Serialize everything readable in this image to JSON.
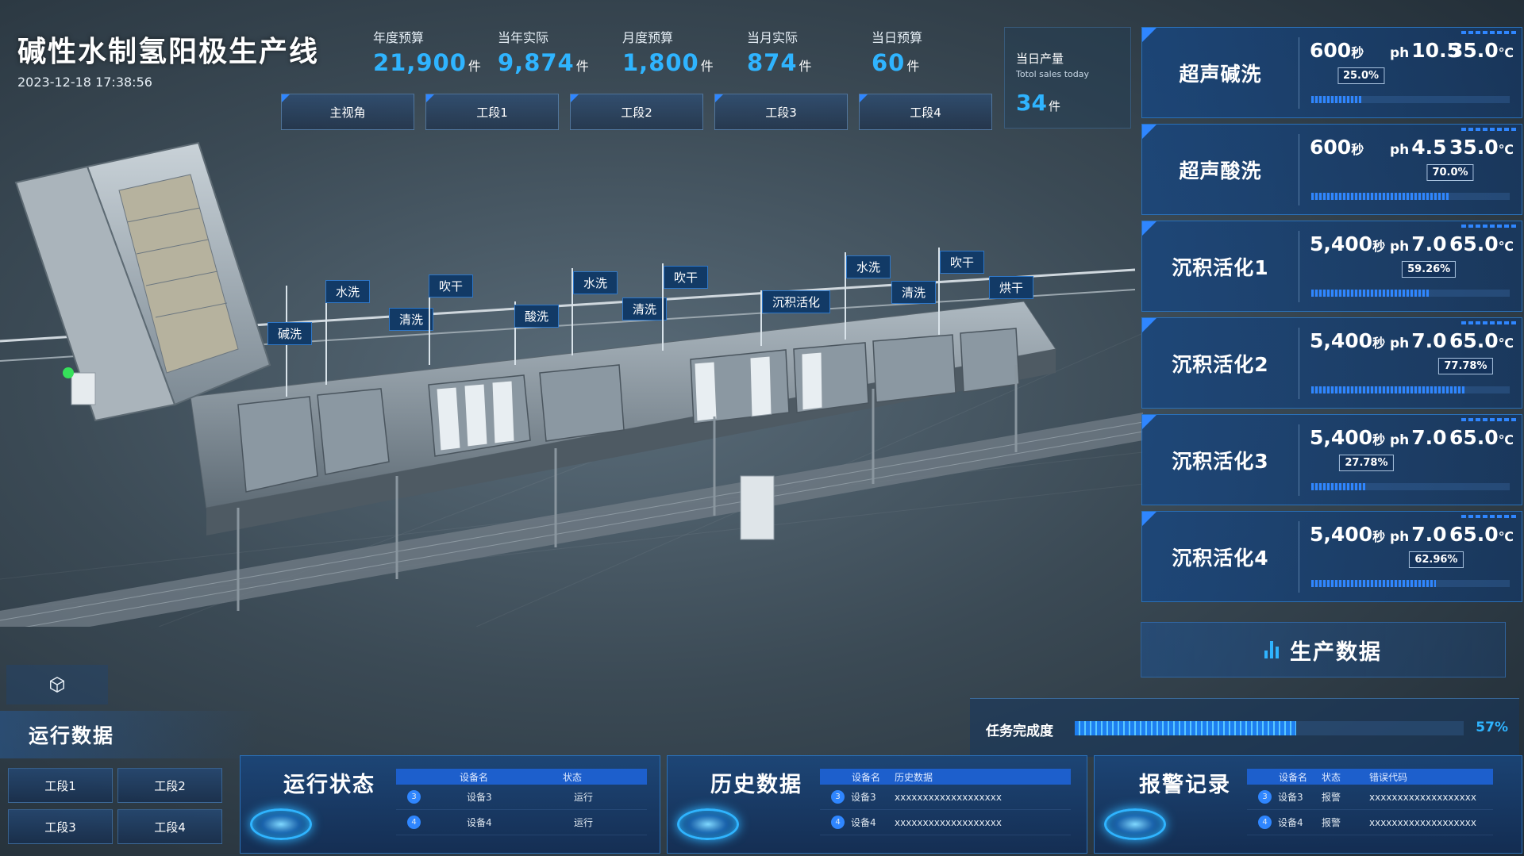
{
  "header": {
    "title": "碱性水制氢阳极生产线",
    "datetime": "2023-12-18 17:38:56",
    "kpis": [
      {
        "label": "年度预算",
        "value": "21,900",
        "unit": "件"
      },
      {
        "label": "当年实际",
        "value": "9,874",
        "unit": "件"
      },
      {
        "label": "月度预算",
        "value": "1,800",
        "unit": "件"
      },
      {
        "label": "当月实际",
        "value": "874",
        "unit": "件"
      },
      {
        "label": "当日预算",
        "value": "60",
        "unit": "件"
      }
    ],
    "daily": {
      "label": "当日产量",
      "sub": "Totol sales today",
      "value": "34",
      "unit": "件"
    }
  },
  "views": [
    "主视角",
    "工段1",
    "工段2",
    "工段3",
    "工段4"
  ],
  "scene_tags": [
    "碱洗",
    "水洗",
    "清洗",
    "吹干",
    "酸洗",
    "水洗",
    "清洗",
    "吹干",
    "沉积活化",
    "水洗",
    "清洗",
    "吹干",
    "烘干"
  ],
  "stations": [
    {
      "name": "超声碱洗",
      "seconds": "600",
      "sec_unit": "秒",
      "ph_label": "ph",
      "ph": "10.5",
      "temp": "35.0",
      "temp_unit": "℃",
      "progress_label": "25.0%",
      "progress": 25.0
    },
    {
      "name": "超声酸洗",
      "seconds": "600",
      "sec_unit": "秒",
      "ph_label": "ph",
      "ph": "4.5",
      "temp": "35.0",
      "temp_unit": "℃",
      "progress_label": "70.0%",
      "progress": 70.0
    },
    {
      "name": "沉积活化1",
      "seconds": "5,400",
      "sec_unit": "秒",
      "ph_label": "ph",
      "ph": "7.0",
      "temp": "65.0",
      "temp_unit": "℃",
      "progress_label": "59.26%",
      "progress": 59.26
    },
    {
      "name": "沉积活化2",
      "seconds": "5,400",
      "sec_unit": "秒",
      "ph_label": "ph",
      "ph": "7.0",
      "temp": "65.0",
      "temp_unit": "℃",
      "progress_label": "77.78%",
      "progress": 77.78
    },
    {
      "name": "沉积活化3",
      "seconds": "5,400",
      "sec_unit": "秒",
      "ph_label": "ph",
      "ph": "7.0",
      "temp": "65.0",
      "temp_unit": "℃",
      "progress_label": "27.78%",
      "progress": 27.78
    },
    {
      "name": "沉积活化4",
      "seconds": "5,400",
      "sec_unit": "秒",
      "ph_label": "ph",
      "ph": "7.0",
      "temp": "65.0",
      "temp_unit": "℃",
      "progress_label": "62.96%",
      "progress": 62.96
    }
  ],
  "production": {
    "title": "生产数据"
  },
  "task": {
    "label": "任务完成度",
    "value_label": "57%",
    "value": 57
  },
  "run_data": {
    "title": "运行数据",
    "segments": [
      "工段1",
      "工段2",
      "工段3",
      "工段4"
    ]
  },
  "panels": {
    "status": {
      "title": "运行状态",
      "headers": [
        "设备名",
        "状态"
      ],
      "rows": [
        {
          "idx": "3",
          "name": "设备3",
          "status": "运行"
        },
        {
          "idx": "4",
          "name": "设备4",
          "status": "运行"
        }
      ]
    },
    "history": {
      "title": "历史数据",
      "headers": [
        "设备名",
        "历史数据"
      ],
      "rows": [
        {
          "idx": "3",
          "name": "设备3",
          "data": "xxxxxxxxxxxxxxxxxxx"
        },
        {
          "idx": "4",
          "name": "设备4",
          "data": "xxxxxxxxxxxxxxxxxxx"
        }
      ]
    },
    "alarm": {
      "title": "报警记录",
      "headers": [
        "设备名",
        "状态",
        "错误代码"
      ],
      "rows": [
        {
          "idx": "3",
          "name": "设备3",
          "status": "报警",
          "code": "xxxxxxxxxxxxxxxxxxx"
        },
        {
          "idx": "4",
          "name": "设备4",
          "status": "报警",
          "code": "xxxxxxxxxxxxxxxxxxx"
        }
      ]
    }
  },
  "colors": {
    "accent": "#2fb4ff",
    "panel": "#1c4a80",
    "tag_bg": "#123a66"
  }
}
